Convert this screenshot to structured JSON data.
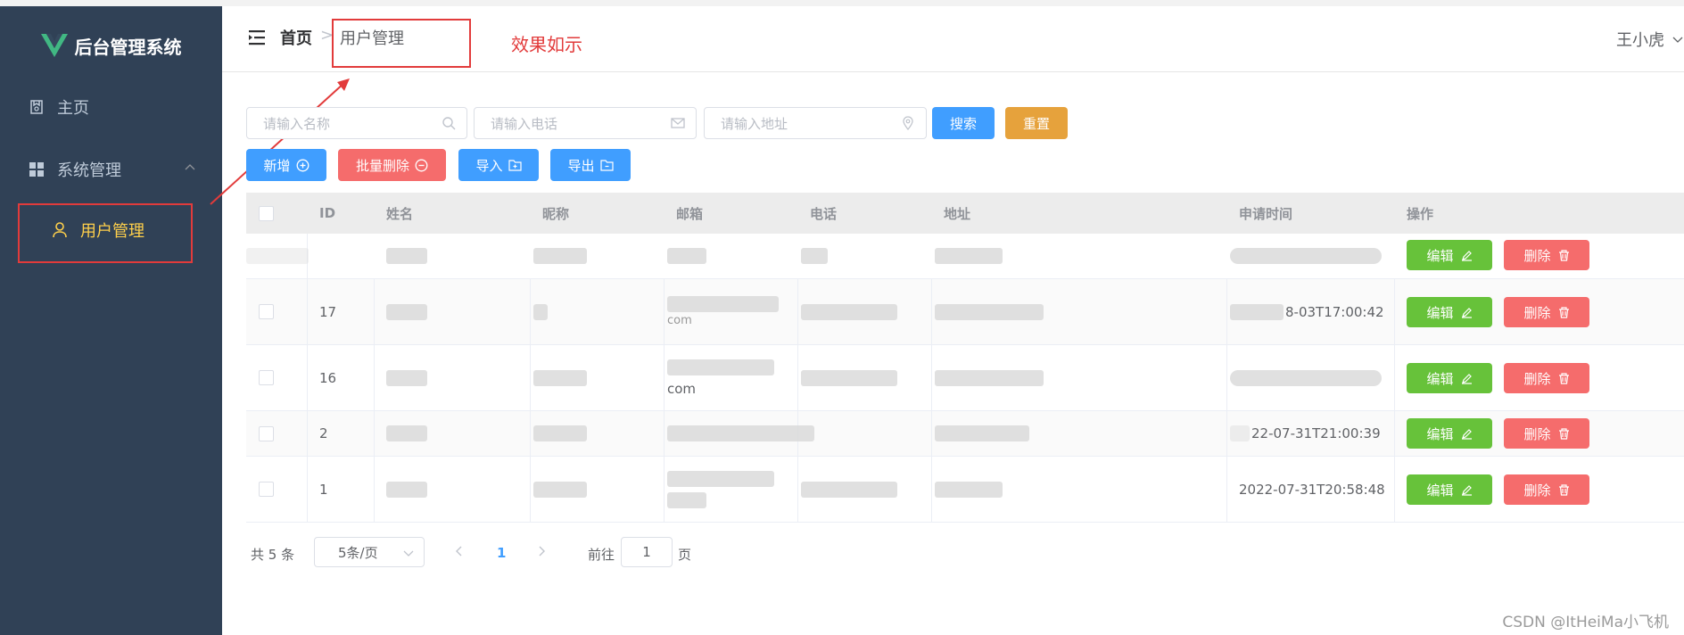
{
  "app": {
    "title": "后台管理系统"
  },
  "sidebar": {
    "items": [
      {
        "label": "主页",
        "icon": "home-icon"
      },
      {
        "label": "系统管理",
        "icon": "grid-icon"
      },
      {
        "label": "用户管理",
        "icon": "user-icon"
      }
    ]
  },
  "header": {
    "breadcrumb_home": "首页",
    "breadcrumb_sep": ">",
    "breadcrumb_current": "用户管理",
    "annotation": "效果如示",
    "user_name": "王小虎"
  },
  "search": {
    "name_placeholder": "请输入名称",
    "phone_placeholder": "请输入电话",
    "address_placeholder": "请输入地址",
    "search_label": "搜索",
    "reset_label": "重置"
  },
  "toolbar": {
    "add_label": "新增",
    "batch_delete_label": "批量删除",
    "import_label": "导入",
    "export_label": "导出"
  },
  "table": {
    "columns": [
      "ID",
      "姓名",
      "昵称",
      "邮箱",
      "电话",
      "地址",
      "申请时间",
      "操作"
    ],
    "rows": [
      {
        "id": "",
        "email": "",
        "time": ""
      },
      {
        "id": "17",
        "email": "com",
        "time": "8-03T17:00:42"
      },
      {
        "id": "16",
        "email": "com",
        "time": ""
      },
      {
        "id": "2",
        "email": "",
        "time": "22-07-31T21:00:39"
      },
      {
        "id": "1",
        "email": "",
        "time": "2022-07-31T20:58:48"
      }
    ],
    "edit_label": "编辑",
    "delete_label": "删除"
  },
  "pagination": {
    "total": "共 5 条",
    "page_size": "5条/页",
    "current": "1",
    "goto_label": "前往",
    "goto_value": "1",
    "page_suffix": "页"
  },
  "watermark": "CSDN @ItHeiMa小飞机",
  "colors": {
    "sidebar_bg": "#304156",
    "active": "#ffd04b",
    "primary": "#409eff",
    "warning": "#e6a23c",
    "danger": "#f56c6c",
    "success": "#67c23a",
    "annotation": "#e23b3b"
  }
}
